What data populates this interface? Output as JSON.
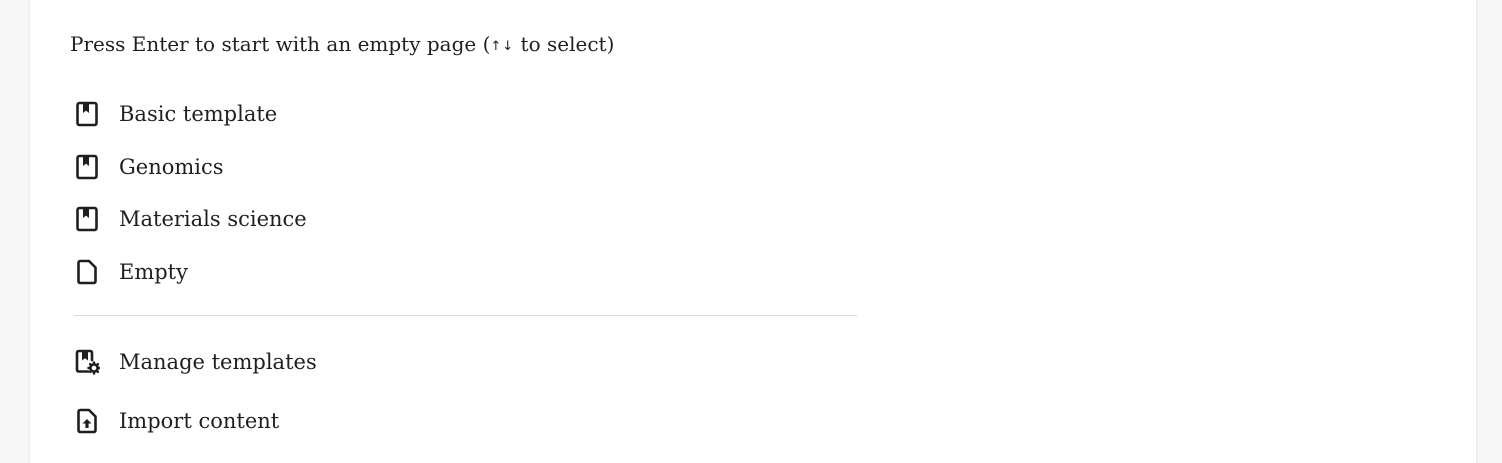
{
  "hint": {
    "prefix": "Press Enter to start with an empty page (",
    "arrows": "↑↓",
    "suffix": " to select)"
  },
  "templates": [
    {
      "label": "Basic template",
      "icon": "template-icon"
    },
    {
      "label": "Genomics",
      "icon": "template-icon"
    },
    {
      "label": "Materials science",
      "icon": "template-icon"
    },
    {
      "label": "Empty",
      "icon": "blank-page-icon"
    }
  ],
  "actions": [
    {
      "label": "Manage templates",
      "icon": "manage-templates-icon"
    },
    {
      "label": "Import content",
      "icon": "import-file-icon"
    }
  ]
}
